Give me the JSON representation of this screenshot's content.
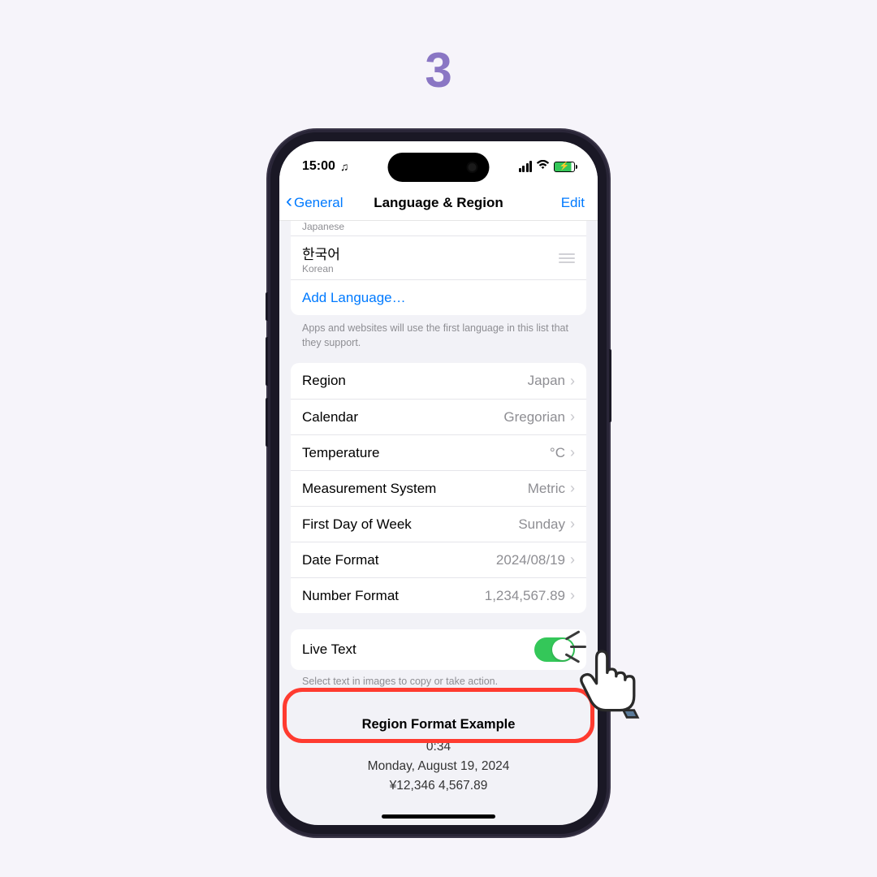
{
  "step": "3",
  "status": {
    "time": "15:00",
    "headphones": "🎧"
  },
  "nav": {
    "back": "General",
    "title": "Language & Region",
    "edit": "Edit"
  },
  "languages": {
    "partial_sub": "Japanese",
    "item": {
      "main": "한국어",
      "sub": "Korean"
    },
    "add": "Add Language…",
    "footer": "Apps and websites will use the first language in this list that they support."
  },
  "settings": {
    "region": {
      "k": "Region",
      "v": "Japan"
    },
    "calendar": {
      "k": "Calendar",
      "v": "Gregorian"
    },
    "temperature": {
      "k": "Temperature",
      "v": "°C"
    },
    "measurement": {
      "k": "Measurement System",
      "v": "Metric"
    },
    "firstday": {
      "k": "First Day of Week",
      "v": "Sunday"
    },
    "dateformat": {
      "k": "Date Format",
      "v": "2024/08/19"
    },
    "numberformat": {
      "k": "Number Format",
      "v": "1,234,567.89"
    }
  },
  "livetext": {
    "label": "Live Text",
    "footer": "Select text in images to copy or take action."
  },
  "example": {
    "head": "Region Format Example",
    "time": "0:34",
    "date": "Monday, August 19, 2024",
    "nums": "¥12,346   4,567.89"
  }
}
